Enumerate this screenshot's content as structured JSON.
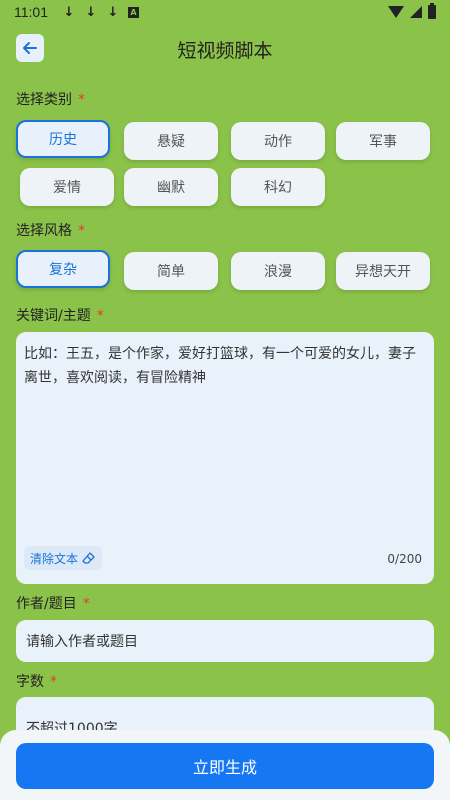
{
  "status": {
    "time": "11:01",
    "download_icon": "↓"
  },
  "header": {
    "back_icon": "arrow-left-icon",
    "title": "短视频脚本"
  },
  "category": {
    "label": "选择类别",
    "required": "*",
    "options": [
      "历史",
      "悬疑",
      "动作",
      "军事",
      "爱情",
      "幽默",
      "科幻"
    ],
    "selected": "历史"
  },
  "style": {
    "label": "选择风格",
    "required": "*",
    "options": [
      "复杂",
      "简单",
      "浪漫",
      "异想天开"
    ],
    "selected": "复杂"
  },
  "keywords": {
    "label": "关键词/主题",
    "required": "*",
    "value": "比如：王五，是个作家，爱好打篮球，有一个可爱的女儿，妻子离世，喜欢阅读，有冒险精神",
    "clear_label": "清除文本",
    "counter": "0/200"
  },
  "author": {
    "label": "作者/题目",
    "required": "*",
    "placeholder": "请输入作者或题目"
  },
  "word_count": {
    "label": "字数",
    "required": "*",
    "placeholder": "不超过1000字"
  },
  "actions": {
    "generate_label": "立即生成"
  },
  "colors": {
    "background": "#8bc34a",
    "accent": "#1a73d9",
    "button": "#1677f2",
    "required": "#e53935"
  }
}
